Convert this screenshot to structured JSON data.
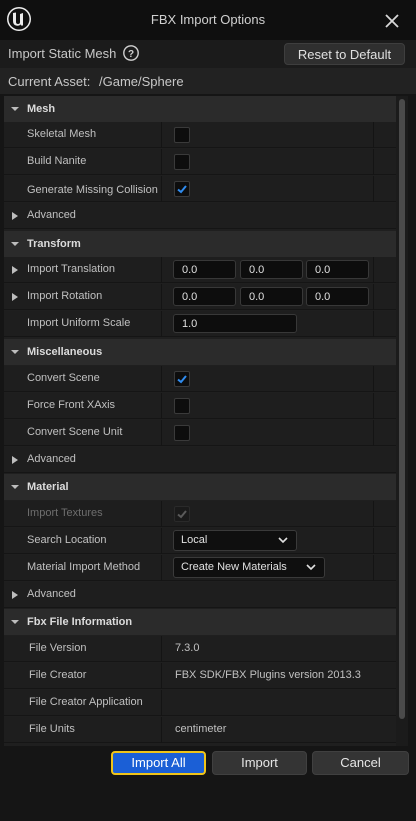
{
  "window": {
    "title": "FBX Import Options"
  },
  "toolbar": {
    "label": "Import Static Mesh",
    "reset_label": "Reset to Default"
  },
  "asset": {
    "label": "Current Asset:",
    "path": "/Game/Sphere"
  },
  "sections": {
    "mesh": {
      "title": "Mesh",
      "skeletal_mesh": "Skeletal Mesh",
      "build_nanite": "Build Nanite",
      "generate_missing_collision": "Generate Missing Collision",
      "advanced": "Advanced"
    },
    "transform": {
      "title": "Transform",
      "import_translation": {
        "label": "Import Translation",
        "x": "0.0",
        "y": "0.0",
        "z": "0.0"
      },
      "import_rotation": {
        "label": "Import Rotation",
        "x": "0.0",
        "y": "0.0",
        "z": "0.0"
      },
      "import_uniform_scale": {
        "label": "Import Uniform Scale",
        "value": "1.0"
      }
    },
    "misc": {
      "title": "Miscellaneous",
      "convert_scene": "Convert Scene",
      "force_front_xaxis": "Force Front XAxis",
      "convert_scene_unit": "Convert Scene Unit",
      "advanced": "Advanced"
    },
    "material": {
      "title": "Material",
      "import_textures": "Import Textures",
      "search_location": {
        "label": "Search Location",
        "value": "Local"
      },
      "material_import_method": {
        "label": "Material Import Method",
        "value": "Create New Materials"
      },
      "advanced": "Advanced"
    },
    "fbx_info": {
      "title": "Fbx File Information",
      "file_version": {
        "label": "File Version",
        "value": "7.3.0"
      },
      "file_creator": {
        "label": "File Creator",
        "value": "FBX SDK/FBX Plugins version 2013.3"
      },
      "file_creator_application": {
        "label": "File Creator Application",
        "value": ""
      },
      "file_units": {
        "label": "File Units",
        "value": "centimeter"
      }
    }
  },
  "checkboxes": {
    "skeletal_mesh": false,
    "build_nanite": false,
    "generate_missing_collision": true,
    "convert_scene": true,
    "force_front_xaxis": false,
    "convert_scene_unit": false,
    "import_textures": true
  },
  "footer": {
    "import_all": "Import All",
    "import": "Import",
    "cancel": "Cancel"
  },
  "colors": {
    "accent": "#1b5fd6",
    "focus": "#f0c419",
    "check": "#2f8cf0"
  },
  "icons": [
    "unreal-logo-icon",
    "close-icon",
    "help-icon",
    "chevron-down-icon",
    "chevron-right-icon",
    "checkmark-icon"
  ]
}
